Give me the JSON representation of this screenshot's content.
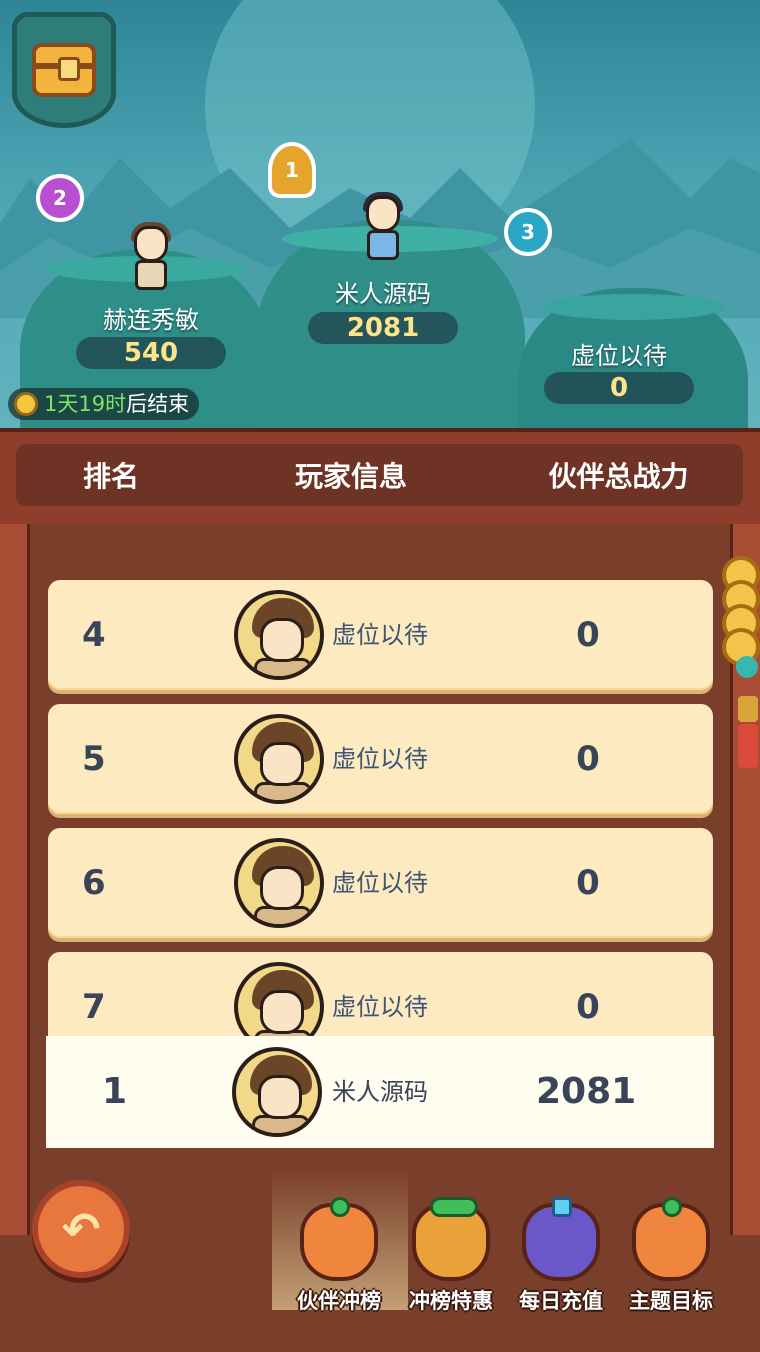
{
  "podium": {
    "first": {
      "rank_badge": "1",
      "name": "米人源码",
      "score": "2081"
    },
    "second": {
      "rank_badge": "2",
      "name": "赫连秀敏",
      "score": "540"
    },
    "third": {
      "rank_badge": "3",
      "name": "虚位以待",
      "score": "0"
    }
  },
  "timer": {
    "highlight": "1天19时",
    "suffix": "后结束"
  },
  "table_header": {
    "rank": "排名",
    "player": "玩家信息",
    "power": "伙伴总战力"
  },
  "rows": [
    {
      "rank": "4",
      "name": "虚位以待",
      "score": "0"
    },
    {
      "rank": "5",
      "name": "虚位以待",
      "score": "0"
    },
    {
      "rank": "6",
      "name": "虚位以待",
      "score": "0"
    },
    {
      "rank": "7",
      "name": "虚位以待",
      "score": "0"
    }
  ],
  "my_rank": {
    "rank": "1",
    "name": "米人源码",
    "score": "2081"
  },
  "bottom_nav": [
    {
      "label": "伙伴冲榜",
      "icon": "bag-icon",
      "color": "#f0853e"
    },
    {
      "label": "冲榜特惠",
      "icon": "jade-bag-icon",
      "color": "#e9a23a"
    },
    {
      "label": "每日充值",
      "icon": "crystal-bag-icon",
      "color": "#6a58c8"
    },
    {
      "label": "主题目标",
      "icon": "bag-icon",
      "color": "#f0853e"
    }
  ],
  "icons": {
    "chest": "treasure-chest-icon",
    "back": "back-arrow-icon",
    "clock": "clock-icon"
  }
}
